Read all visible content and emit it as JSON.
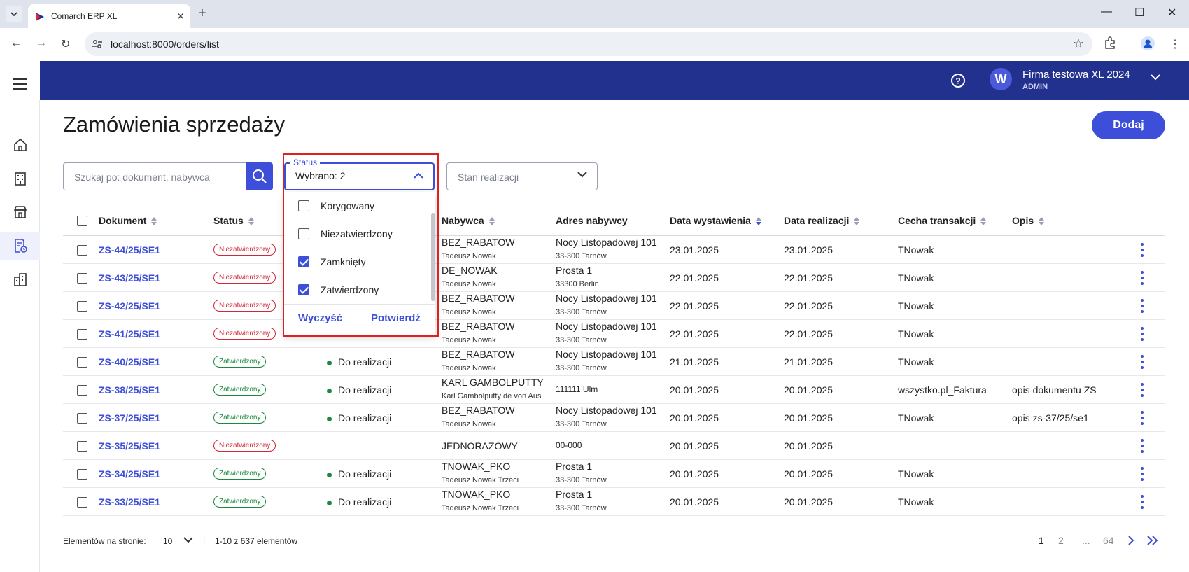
{
  "browser": {
    "tab_title": "Comarch ERP XL",
    "url": "localhost:8000/orders/list"
  },
  "header": {
    "company": "Firma testowa XL 2024",
    "role": "ADMIN",
    "avatar_letter": "W"
  },
  "page": {
    "title": "Zamówienia sprzedaży",
    "add_label": "Dodaj"
  },
  "filters": {
    "search_placeholder": "Szukaj po: dokument, nabywca",
    "status_label": "Status",
    "status_value": "Wybrano: 2",
    "stan_placeholder": "Stan realizacji",
    "status_options": [
      {
        "label": "Korygowany",
        "checked": false
      },
      {
        "label": "Niezatwierdzony",
        "checked": false
      },
      {
        "label": "Zamknięty",
        "checked": true
      },
      {
        "label": "Zatwierdzony",
        "checked": true
      }
    ],
    "clear_label": "Wyczyść",
    "confirm_label": "Potwierdź"
  },
  "table": {
    "headers": [
      "Dokument",
      "Status",
      "Nabywca",
      "Adres nabywcy",
      "Data wystawienia",
      "Data realizacji",
      "Cecha transakcji",
      "Opis"
    ],
    "rows": [
      {
        "doc": "ZS-44/25/SE1",
        "status": "Niezatwierdzony",
        "status_color": "red",
        "stan": "",
        "buyer": "BEZ_RABATOW",
        "buyer_sub": "Tadeusz Nowak",
        "addr": "Nocy Listopadowej 101",
        "addr_sub": "33-300 Tarnów",
        "issued": "23.01.2025",
        "realized": "23.01.2025",
        "feature": "TNowak",
        "desc": "–"
      },
      {
        "doc": "ZS-43/25/SE1",
        "status": "Niezatwierdzony",
        "status_color": "red",
        "stan": "",
        "buyer": "DE_NOWAK",
        "buyer_sub": "Tadeusz Nowak",
        "addr": "Prosta 1",
        "addr_sub": "33300 Berlin",
        "issued": "22.01.2025",
        "realized": "22.01.2025",
        "feature": "TNowak",
        "desc": "–"
      },
      {
        "doc": "ZS-42/25/SE1",
        "status": "Niezatwierdzony",
        "status_color": "red",
        "stan": "",
        "buyer": "BEZ_RABATOW",
        "buyer_sub": "Tadeusz Nowak",
        "addr": "Nocy Listopadowej 101",
        "addr_sub": "33-300 Tarnów",
        "issued": "22.01.2025",
        "realized": "22.01.2025",
        "feature": "TNowak",
        "desc": "–"
      },
      {
        "doc": "ZS-41/25/SE1",
        "status": "Niezatwierdzony",
        "status_color": "red",
        "stan": "",
        "buyer": "BEZ_RABATOW",
        "buyer_sub": "Tadeusz Nowak",
        "addr": "Nocy Listopadowej 101",
        "addr_sub": "33-300 Tarnów",
        "issued": "22.01.2025",
        "realized": "22.01.2025",
        "feature": "TNowak",
        "desc": "–"
      },
      {
        "doc": "ZS-40/25/SE1",
        "status": "Zatwierdzony",
        "status_color": "green",
        "stan": "Do realizacji",
        "buyer": "BEZ_RABATOW",
        "buyer_sub": "Tadeusz Nowak",
        "addr": "Nocy Listopadowej 101",
        "addr_sub": "33-300 Tarnów",
        "issued": "21.01.2025",
        "realized": "21.01.2025",
        "feature": "TNowak",
        "desc": "–"
      },
      {
        "doc": "ZS-38/25/SE1",
        "status": "Zatwierdzony",
        "status_color": "green",
        "stan": "Do realizacji",
        "buyer": "KARL GAMBOLPUTTY",
        "buyer_sub": "Karl Gambolputty de von Aus",
        "addr": "111111 Ulm",
        "addr_sub": "",
        "issued": "20.01.2025",
        "realized": "20.01.2025",
        "feature": "wszystko.pl_Faktura",
        "desc": "opis dokumentu ZS"
      },
      {
        "doc": "ZS-37/25/SE1",
        "status": "Zatwierdzony",
        "status_color": "green",
        "stan": "Do realizacji",
        "buyer": "BEZ_RABATOW",
        "buyer_sub": "Tadeusz Nowak",
        "addr": "Nocy Listopadowej 101",
        "addr_sub": "33-300 Tarnów",
        "issued": "20.01.2025",
        "realized": "20.01.2025",
        "feature": "TNowak",
        "desc": "opis zs-37/25/se1"
      },
      {
        "doc": "ZS-35/25/SE1",
        "status": "Niezatwierdzony",
        "status_color": "red",
        "stan": "–",
        "buyer": "JEDNORAZOWY",
        "buyer_sub": "",
        "addr": "00-000",
        "addr_sub": "",
        "issued": "20.01.2025",
        "realized": "20.01.2025",
        "feature": "–",
        "desc": "–"
      },
      {
        "doc": "ZS-34/25/SE1",
        "status": "Zatwierdzony",
        "status_color": "green",
        "stan": "Do realizacji",
        "buyer": "TNOWAK_PKO",
        "buyer_sub": "Tadeusz Nowak Trzeci",
        "addr": "Prosta 1",
        "addr_sub": "33-300 Tarnów",
        "issued": "20.01.2025",
        "realized": "20.01.2025",
        "feature": "TNowak",
        "desc": "–"
      },
      {
        "doc": "ZS-33/25/SE1",
        "status": "Zatwierdzony",
        "status_color": "green",
        "stan": "Do realizacji",
        "buyer": "TNOWAK_PKO",
        "buyer_sub": "Tadeusz Nowak Trzeci",
        "addr": "Prosta 1",
        "addr_sub": "33-300 Tarnów",
        "issued": "20.01.2025",
        "realized": "20.01.2025",
        "feature": "TNowak",
        "desc": "–"
      }
    ]
  },
  "pagination": {
    "per_page_label": "Elementów na stronie:",
    "per_page": "10",
    "separator": "|",
    "range": "1-10 z 637 elementów",
    "pages": [
      "1",
      "2",
      "...",
      "64"
    ]
  },
  "colors": {
    "accent": "#3d4ed8",
    "header_bg": "#23318e",
    "status_red": "#d0283b",
    "status_green": "#1c8a3c"
  }
}
